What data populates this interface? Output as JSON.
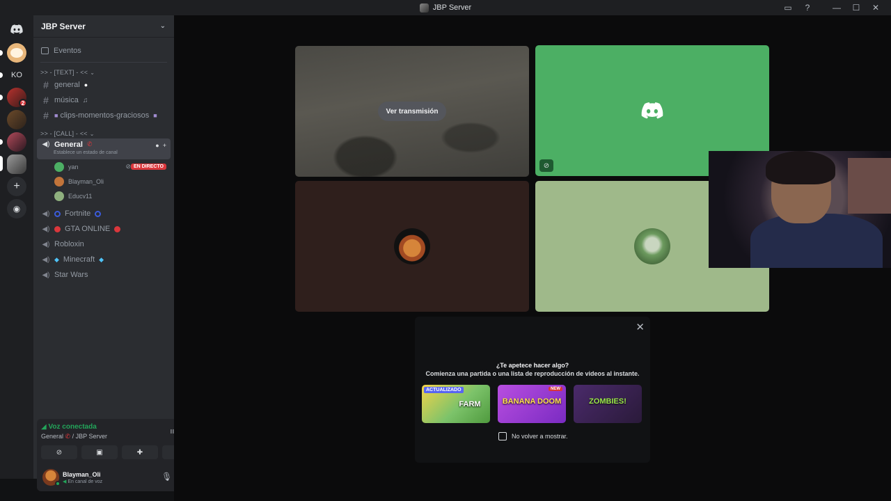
{
  "window": {
    "title": "JBP Server"
  },
  "guilds": [
    {
      "name": "bear-server",
      "initials": ""
    },
    {
      "name": "ko-server",
      "initials": "KO"
    },
    {
      "name": "star-server",
      "initials": "",
      "badge": "2"
    },
    {
      "name": "horse-server",
      "initials": ""
    },
    {
      "name": "anime-server",
      "initials": ""
    },
    {
      "name": "jbp-server",
      "initials": ""
    }
  ],
  "server": {
    "name": "JBP Server",
    "events_label": "Eventos",
    "category_text": ">> - [TEXT] - <<",
    "text_channels": [
      "general",
      "música",
      "clips-momentos-graciosos"
    ],
    "category_call": ">> - [CALL] - <<",
    "active_voice": {
      "name": "General",
      "status": "Establece un estado de canal"
    },
    "voice_users": [
      {
        "name": "yan",
        "live": "EN DIRECTO"
      },
      {
        "name": "Blayman_Oli"
      },
      {
        "name": "Educv11"
      }
    ],
    "voice_channels": [
      "Fortnite",
      "GTA ONLINE",
      "Robloxin",
      "Minecraft",
      "Star Wars"
    ]
  },
  "voice_panel": {
    "title": "Voz conectada",
    "subtitle": "General",
    "server": " / JBP Server"
  },
  "user": {
    "name": "Blayman_Oli",
    "status": "En canal de voz"
  },
  "stage": {
    "watch_label": "Ver transmisión"
  },
  "activity": {
    "title": "¿Te apetece hacer algo?",
    "subtitle": "Comienza una partida o una lista de reproducción de videos al instante.",
    "cards": [
      {
        "label": "ACTUALIZADO",
        "title": "FARM"
      },
      {
        "label": "NEW",
        "title": "BANANA DOOM"
      },
      {
        "label": "",
        "title": "ZOMBIES!"
      }
    ],
    "checkbox_label": "No volver a mostrar."
  },
  "colors": {
    "accent": "#5865f2",
    "green": "#23a55a",
    "danger": "#da373c"
  }
}
